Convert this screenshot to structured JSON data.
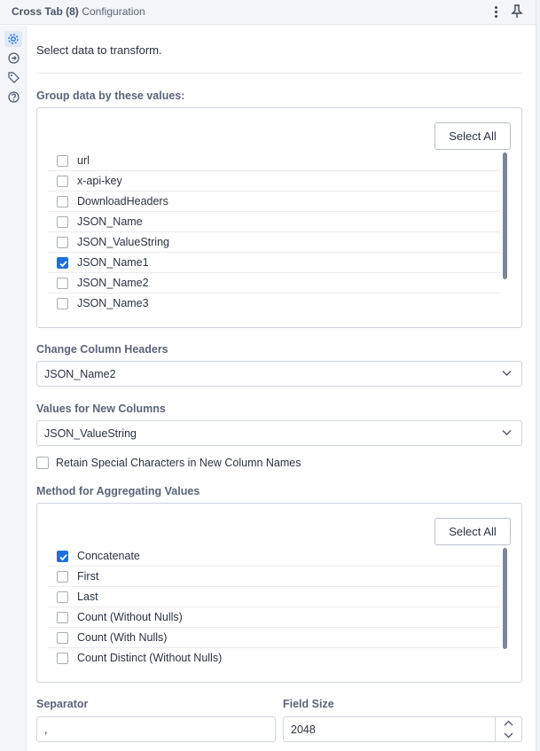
{
  "window": {
    "title": "Cross Tab (8)",
    "subtitle": "- Configuration",
    "menu_icon": "kebab-icon",
    "pin_icon": "pin-icon"
  },
  "rail": {
    "items": [
      "gear-icon",
      "connection-icon",
      "tag-icon",
      "help-icon"
    ]
  },
  "intro": "Select data to transform.",
  "group_by": {
    "label": "Group data by these values:",
    "select_all": "Select All",
    "items": [
      {
        "label": "url",
        "checked": false
      },
      {
        "label": "x-api-key",
        "checked": false
      },
      {
        "label": "DownloadHeaders",
        "checked": false
      },
      {
        "label": "JSON_Name",
        "checked": false
      },
      {
        "label": "JSON_ValueString",
        "checked": false
      },
      {
        "label": "JSON_Name1",
        "checked": true
      },
      {
        "label": "JSON_Name2",
        "checked": false
      },
      {
        "label": "JSON_Name3",
        "checked": false
      }
    ]
  },
  "headers": {
    "label": "Change Column Headers",
    "value": "JSON_Name2"
  },
  "values": {
    "label": "Values for New Columns",
    "value": "JSON_ValueString"
  },
  "retain": {
    "label": "Retain Special Characters in New Column Names",
    "checked": false
  },
  "method": {
    "label": "Method for Aggregating Values",
    "select_all": "Select All",
    "items": [
      {
        "label": "Concatenate",
        "checked": true
      },
      {
        "label": "First",
        "checked": false
      },
      {
        "label": "Last",
        "checked": false
      },
      {
        "label": "Count (Without Nulls)",
        "checked": false
      },
      {
        "label": "Count (With Nulls)",
        "checked": false
      },
      {
        "label": "Count Distinct (Without Nulls)",
        "checked": false
      }
    ]
  },
  "separator": {
    "label": "Separator",
    "value": ","
  },
  "field_size": {
    "label": "Field Size",
    "value": "2048"
  },
  "colors": {
    "accent": "#1e6fd9",
    "label": "#5b6577",
    "border": "#cfd5de"
  }
}
